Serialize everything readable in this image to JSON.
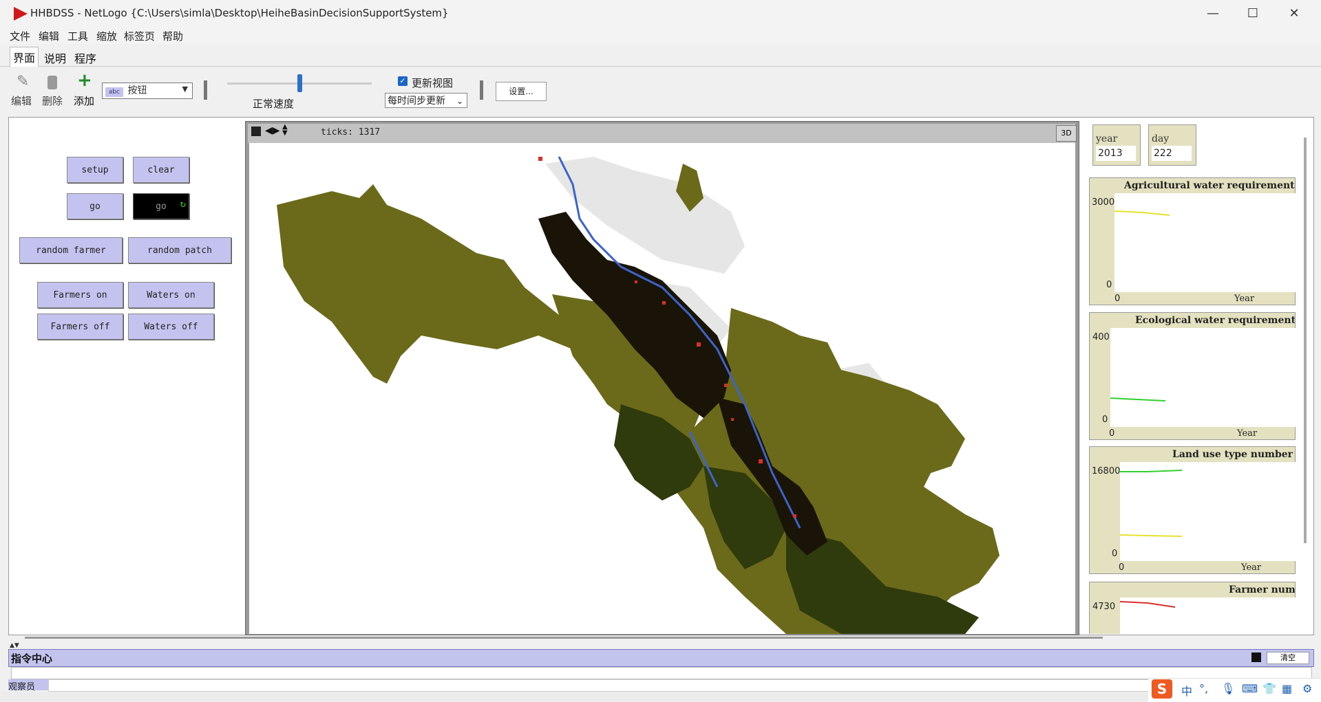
{
  "window": {
    "title": "HHBDSS - NetLogo {C:\\Users\\simla\\Desktop\\HeiheBasinDecisionSupportSystem}",
    "minimize": "—",
    "maximize": "☐",
    "close": "✕"
  },
  "menu": [
    "文件",
    "编辑",
    "工具",
    "缩放",
    "标签页",
    "帮助"
  ],
  "tabs": [
    "界面",
    "说明",
    "程序"
  ],
  "toolbar": {
    "edit_label": "编辑",
    "delete_label": "删除",
    "add_label": "添加",
    "widget_type": "按钮",
    "speed_label": "正常速度",
    "update_view_label": "更新视图",
    "update_mode": "每时间步更新",
    "settings_label": "设置..."
  },
  "buttons": {
    "setup": "setup",
    "clear": "clear",
    "go_once": "go",
    "go_forever": "go",
    "random_farmer": "random farmer",
    "random_patch": "random patch",
    "farmers_on": "Farmers on",
    "waters_on": "Waters on",
    "farmers_off": "Farmers off",
    "waters_off": "Waters off"
  },
  "view": {
    "ticks_label": "ticks: 1317",
    "btn_3d": "3D"
  },
  "monitors": [
    {
      "label": "year",
      "value": "2013"
    },
    {
      "label": "day",
      "value": "222"
    }
  ],
  "plots": [
    {
      "title": "Agricultural water requirement",
      "ymax": "3000",
      "ymin": "0",
      "xmin": "0",
      "xlabel": "Year"
    },
    {
      "title": "Ecological water requirement",
      "ymax": "400",
      "ymin": "0",
      "xmin": "0",
      "xlabel": "Year"
    },
    {
      "title": "Land use type number",
      "ymax": "16800",
      "ymin": "0",
      "xmin": "0",
      "xlabel": "Year"
    },
    {
      "title": "Farmer number",
      "ymax": "4730",
      "ymin": "",
      "xmin": "",
      "xlabel": ""
    }
  ],
  "command_center": {
    "title": "指令中心",
    "clear_label": "清空",
    "observer_label": "观察员"
  },
  "ime": {
    "logo": "S",
    "mode": "中"
  },
  "colors": {
    "button_fill": "#c4c3f0",
    "monitor_fill": "#e3e1bf",
    "land_olive": "#6b6a1a",
    "land_dark": "#2f3a0d",
    "land_black": "#1a1408",
    "water_blue": "#3d64c8",
    "urban_red": "#d7302a",
    "bare_gray": "#e4e4e4"
  }
}
